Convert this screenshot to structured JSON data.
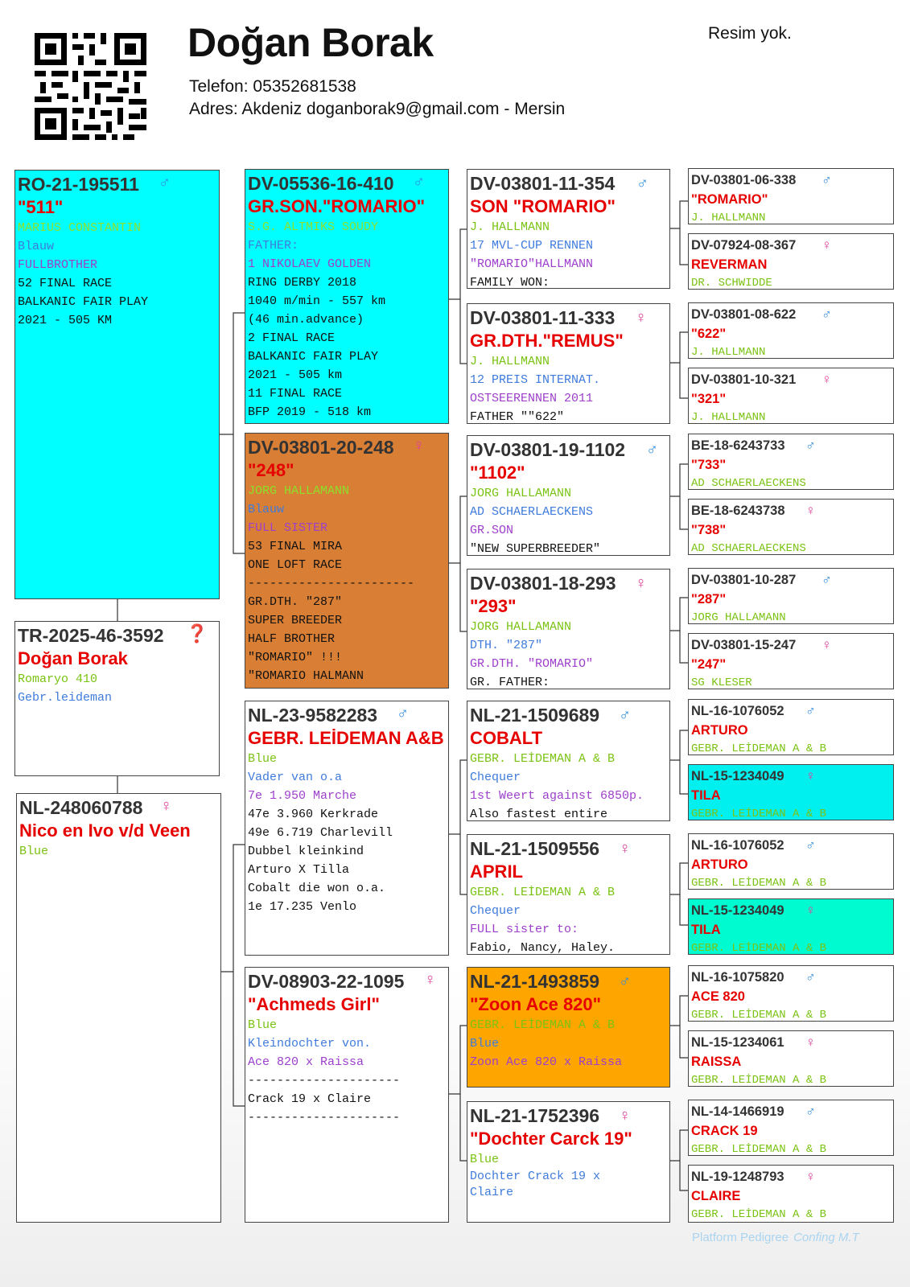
{
  "header": {
    "name": "Doğan Borak",
    "phone": "Telefon: 05352681538",
    "address": "Adres: Akdeniz doganborak9@gmail.com - Mersin",
    "photo_note": "Resim yok."
  },
  "colors": {
    "cyan": "#00ffff",
    "brown": "#d97f35",
    "orange": "#ffa500",
    "aqua": "#00f0f0",
    "mint": "#00fbd0",
    "name_red": "#e60000",
    "male_blue": "#2f8de0",
    "female_pink": "#e0409a"
  },
  "cards": {
    "subject": {
      "ring": "TR-2025-46-3592",
      "sex": "❓",
      "name": "Doğan Borak",
      "lines": [
        {
          "t": "Romaryo 410",
          "c": "green"
        },
        {
          "t": "Gebr.leideman",
          "c": "blue"
        }
      ]
    },
    "sire": {
      "ring": "RO-21-195511",
      "sex": "♂",
      "name": "\"511\"",
      "lines": [
        {
          "t": "MARIUS CONSTANTIN",
          "c": "lime"
        },
        {
          "t": "Blauw",
          "c": "blue"
        },
        {
          "t": "FULLBROTHER",
          "c": "purple"
        },
        {
          "t": "52 FINAL RACE",
          "c": "black"
        },
        {
          "t": "BALKANIC FAIR PLAY",
          "c": "black"
        },
        {
          "t": "2021 - 505 KM",
          "c": "black"
        }
      ]
    },
    "dam": {
      "ring": "NL-248060788",
      "sex": "♀",
      "name": "Nico en Ivo v/d Veen",
      "lines": [
        {
          "t": "Blue",
          "c": "green"
        }
      ]
    },
    "ss": {
      "ring": "DV-05536-16-410",
      "sex": "♂",
      "name": "GR.SON.\"ROMARIO\"",
      "lines": [
        {
          "t": "S.G. ALTMIKS SOUDY",
          "c": "lime"
        },
        {
          "t": "FATHER:",
          "c": "blue"
        },
        {
          "t": "1 NIKOLAEV GOLDEN",
          "c": "purple"
        },
        {
          "t": "RING DERBY 2018",
          "c": "black"
        },
        {
          "t": "1040 m/min - 557 km",
          "c": "black"
        },
        {
          "t": "(46 min.advance)",
          "c": "black"
        },
        {
          "t": "2 FINAL RACE",
          "c": "black"
        },
        {
          "t": "BALKANIC FAIR PLAY",
          "c": "black"
        },
        {
          "t": "2021 - 505 km",
          "c": "black"
        },
        {
          "t": "11 FINAL RACE",
          "c": "black"
        },
        {
          "t": "BFP 2019 - 518 km",
          "c": "black"
        }
      ]
    },
    "sd": {
      "ring": "DV-03801-20-248",
      "sex": "♀",
      "name": "\"248\"",
      "lines": [
        {
          "t": "JORG HALLAMANN",
          "c": "lime"
        },
        {
          "t": "Blauw",
          "c": "blue"
        },
        {
          "t": "FULL SISTER",
          "c": "purple"
        },
        {
          "t": "53 FINAL MIRA",
          "c": "black"
        },
        {
          "t": "ONE LOFT RACE",
          "c": "black"
        },
        {
          "t": "-----------------------",
          "c": "black"
        },
        {
          "t": "GR.DTH. \"287\"",
          "c": "black"
        },
        {
          "t": "SUPER BREEDER",
          "c": "black"
        },
        {
          "t": "HALF BROTHER",
          "c": "black"
        },
        {
          "t": "\"ROMARIO\" !!!",
          "c": "black"
        },
        {
          "t": "\"ROMARIO HALMANN",
          "c": "black"
        }
      ]
    },
    "ds": {
      "ring": "NL-23-9582283",
      "sex": "♂",
      "name": "GEBR. LEİDEMAN A&B",
      "lines": [
        {
          "t": "Blue",
          "c": "green"
        },
        {
          "t": "Vader van o.a",
          "c": "blue"
        },
        {
          "t": "7e 1.950 Marche",
          "c": "purple"
        },
        {
          "t": "47e 3.960 Kerkrade",
          "c": "black"
        },
        {
          "t": "49e 6.719 Charlevill",
          "c": "black"
        },
        {
          "t": "Dubbel kleinkind",
          "c": "black"
        },
        {
          "t": "Arturo X Tilla",
          "c": "black"
        },
        {
          "t": "Cobalt die won o.a.",
          "c": "black"
        },
        {
          "t": "1e 17.235 Venlo",
          "c": "black"
        }
      ]
    },
    "dd": {
      "ring": "DV-08903-22-1095",
      "sex": "♀",
      "name": "\"Achmeds Girl\"",
      "lines": [
        {
          "t": "Blue",
          "c": "green"
        },
        {
          "t": "Kleindochter von.",
          "c": "blue"
        },
        {
          "t": "Ace 820 x Raissa",
          "c": "purple"
        },
        {
          "t": "---------------------",
          "c": "black"
        },
        {
          "t": "Crack 19 x Claire",
          "c": "black"
        },
        {
          "t": "---------------------",
          "c": "black"
        }
      ]
    },
    "sss": {
      "ring": "DV-03801-11-354",
      "sex": "♂",
      "name": "SON \"ROMARIO\"",
      "lines": [
        {
          "t": "J. HALLMANN",
          "c": "green"
        },
        {
          "t": "17 MVL-CUP RENNEN",
          "c": "blue"
        },
        {
          "t": "\"ROMARIO\"HALLMANN",
          "c": "purple"
        },
        {
          "t": "FAMILY WON:",
          "c": "black"
        }
      ]
    },
    "ssd": {
      "ring": "DV-03801-11-333",
      "sex": "♀",
      "name": "GR.DTH.\"REMUS\"",
      "lines": [
        {
          "t": "J. HALLMANN",
          "c": "green"
        },
        {
          "t": "12 PREIS INTERNAT.",
          "c": "blue"
        },
        {
          "t": "OSTSEERENNEN 2011",
          "c": "purple"
        },
        {
          "t": "FATHER \"\"622\"",
          "c": "black"
        }
      ]
    },
    "sds": {
      "ring": "DV-03801-19-1102",
      "sex": "♂",
      "name": "\"1102\"",
      "lines": [
        {
          "t": "JORG HALLAMANN",
          "c": "green"
        },
        {
          "t": "AD SCHAERLAECKENS",
          "c": "blue"
        },
        {
          "t": "GR.SON",
          "c": "purple"
        },
        {
          "t": "\"NEW SUPERBREEDER\"",
          "c": "black"
        }
      ]
    },
    "sdd": {
      "ring": "DV-03801-18-293",
      "sex": "♀",
      "name": "\"293\"",
      "lines": [
        {
          "t": "JORG HALLAMANN",
          "c": "green"
        },
        {
          "t": "DTH. \"287\"",
          "c": "blue"
        },
        {
          "t": "GR.DTH. \"ROMARIO\"",
          "c": "purple"
        },
        {
          "t": "GR. FATHER:",
          "c": "black"
        }
      ]
    },
    "dss": {
      "ring": "NL-21-1509689",
      "sex": "♂",
      "name": "COBALT",
      "lines": [
        {
          "t": "GEBR. LEİDEMAN A & B",
          "c": "green"
        },
        {
          "t": "Chequer",
          "c": "blue"
        },
        {
          "t": "1st Weert against 6850p.",
          "c": "purple"
        },
        {
          "t": "Also fastest entire",
          "c": "black"
        }
      ]
    },
    "dsd": {
      "ring": "NL-21-1509556",
      "sex": "♀",
      "name": "APRIL",
      "lines": [
        {
          "t": "GEBR. LEİDEMAN A & B",
          "c": "green"
        },
        {
          "t": "Chequer",
          "c": "blue"
        },
        {
          "t": "FULL sister to:",
          "c": "purple"
        },
        {
          "t": "Fabio, Nancy, Haley.",
          "c": "black"
        }
      ]
    },
    "dds": {
      "ring": "NL-21-1493859",
      "sex": "♂",
      "name": "\"Zoon Ace 820\"",
      "lines": [
        {
          "t": "GEBR. LEİDEMAN A & B",
          "c": "green"
        },
        {
          "t": "Blue",
          "c": "blue"
        },
        {
          "t": "Zoon Ace 820 x Raissa",
          "c": "purple"
        }
      ]
    },
    "ddd": {
      "ring": "NL-21-1752396",
      "sex": "♀",
      "name": "\"Dochter Carck 19\"",
      "lines": [
        {
          "t": "Blue",
          "c": "green"
        },
        {
          "t": "Dochter Crack 19 x",
          "c": "blue"
        },
        {
          "t": "Claire",
          "c": "blue"
        }
      ]
    },
    "g3_1": {
      "ring": "DV-03801-06-338",
      "sex": "♂",
      "name": "\"ROMARIO\"",
      "lines": [
        {
          "t": "J. HALLMANN",
          "c": "green"
        }
      ]
    },
    "g3_2": {
      "ring": "DV-07924-08-367",
      "sex": "♀",
      "name": "REVERMAN",
      "lines": [
        {
          "t": "DR. SCHWIDDE",
          "c": "green"
        }
      ]
    },
    "g3_3": {
      "ring": "DV-03801-08-622",
      "sex": "♂",
      "name": "\"622\"",
      "lines": [
        {
          "t": "J. HALLMANN",
          "c": "green"
        }
      ]
    },
    "g3_4": {
      "ring": "DV-03801-10-321",
      "sex": "♀",
      "name": "\"321\"",
      "lines": [
        {
          "t": "J. HALLMANN",
          "c": "green"
        }
      ]
    },
    "g3_5": {
      "ring": "BE-18-6243733",
      "sex": "♂",
      "name": "\"733\"",
      "lines": [
        {
          "t": "AD SCHAERLAECKENS",
          "c": "green"
        }
      ]
    },
    "g3_6": {
      "ring": "BE-18-6243738",
      "sex": "♀",
      "name": "\"738\"",
      "lines": [
        {
          "t": "AD SCHAERLAECKENS",
          "c": "green"
        }
      ]
    },
    "g3_7": {
      "ring": "DV-03801-10-287",
      "sex": "♂",
      "name": "\"287\"",
      "lines": [
        {
          "t": "JORG HALLAMANN",
          "c": "green"
        }
      ]
    },
    "g3_8": {
      "ring": "DV-03801-15-247",
      "sex": "♀",
      "name": "\"247\"",
      "lines": [
        {
          "t": "SG KLESER",
          "c": "green"
        }
      ]
    },
    "g3_9": {
      "ring": "NL-16-1076052",
      "sex": "♂",
      "name": "ARTURO",
      "lines": [
        {
          "t": "GEBR. LEİDEMAN A & B",
          "c": "green"
        }
      ]
    },
    "g3_10": {
      "ring": "NL-15-1234049",
      "sex": "♀",
      "name": "TILA",
      "lines": [
        {
          "t": "GEBR. LEİDEMAN A & B",
          "c": "green"
        }
      ]
    },
    "g3_11": {
      "ring": "NL-16-1076052",
      "sex": "♂",
      "name": "ARTURO",
      "lines": [
        {
          "t": "GEBR. LEİDEMAN A & B",
          "c": "green"
        }
      ]
    },
    "g3_12": {
      "ring": "NL-15-1234049",
      "sex": "♀",
      "name": "TILA",
      "lines": [
        {
          "t": "GEBR. LEİDEMAN A & B",
          "c": "green"
        }
      ]
    },
    "g3_13": {
      "ring": "NL-16-1075820",
      "sex": "♂",
      "name": "ACE 820",
      "lines": [
        {
          "t": "GEBR. LEİDEMAN A & B",
          "c": "green"
        }
      ]
    },
    "g3_14": {
      "ring": "NL-15-1234061",
      "sex": "♀",
      "name": "RAISSA",
      "lines": [
        {
          "t": "GEBR. LEİDEMAN A & B",
          "c": "green"
        }
      ]
    },
    "g3_15": {
      "ring": "NL-14-1466919",
      "sex": "♂",
      "name": "CRACK 19",
      "lines": [
        {
          "t": "GEBR. LEİDEMAN A & B",
          "c": "green"
        }
      ]
    },
    "g3_16": {
      "ring": "NL-19-1248793",
      "sex": "♀",
      "name": "CLAIRE",
      "lines": [
        {
          "t": "GEBR. LEİDEMAN A & B",
          "c": "green"
        }
      ]
    }
  },
  "footer": {
    "platform": "Platform Pedigree",
    "config": "Confing M.T"
  }
}
